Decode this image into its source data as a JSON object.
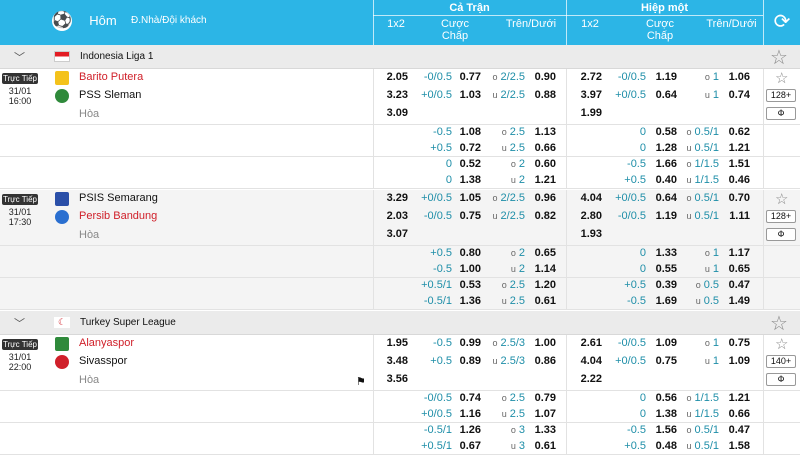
{
  "header": {
    "tab_today": "Hôm Nay",
    "hint": "Đ.Nhà/Đội khách",
    "full_time": "Cả Trận",
    "half_time": "Hiệp một",
    "col_1x2": "1x2",
    "col_handicap_1": "Cược",
    "col_handicap_2": "Chấp",
    "col_ou": "Trên/Dưới"
  },
  "leagues": [
    {
      "name": "Indonesia Liga 1"
    },
    {
      "name": "Turkey Super League"
    }
  ],
  "live_label": "Trực Tiếp",
  "matches": [
    {
      "date": "31/01",
      "time": "16:00",
      "home": "Barito Putera",
      "away": "PSS Sleman",
      "draw": "Hòa",
      "more": "128+",
      "mid_sym": "Ф",
      "main": [
        [
          "2.05",
          "-0/0.5",
          "0.77",
          "o",
          "2/2.5",
          "0.90",
          "2.72",
          "-0/0.5",
          "1.19",
          "o",
          "1",
          "1.06"
        ],
        [
          "3.23",
          "+0/0.5",
          "1.03",
          "u",
          "2/2.5",
          "0.88",
          "3.97",
          "+0/0.5",
          "0.64",
          "u",
          "1",
          "0.74"
        ],
        [
          "3.09",
          "",
          "",
          "",
          "",
          "",
          "1.99",
          "",
          "",
          "",
          "",
          ""
        ]
      ],
      "extra": [
        [
          "-0.5",
          "1.08",
          "o",
          "2.5",
          "1.13",
          "0",
          "0.58",
          "o",
          "0.5/1",
          "0.62"
        ],
        [
          "+0.5",
          "0.72",
          "u",
          "2.5",
          "0.66",
          "0",
          "1.28",
          "u",
          "0.5/1",
          "1.21"
        ],
        [
          "0",
          "0.52",
          "o",
          "2",
          "0.60",
          "-0.5",
          "1.66",
          "o",
          "1/1.5",
          "1.51"
        ],
        [
          "0",
          "1.38",
          "u",
          "2",
          "1.21",
          "+0.5",
          "0.40",
          "u",
          "1/1.5",
          "0.46"
        ]
      ]
    },
    {
      "date": "31/01",
      "time": "17:30",
      "home": "PSIS Semarang",
      "away": "Persib Bandung",
      "draw": "Hòa",
      "more": "128+",
      "mid_sym": "Ф",
      "main": [
        [
          "3.29",
          "+0/0.5",
          "1.05",
          "o",
          "2/2.5",
          "0.96",
          "4.04",
          "+0/0.5",
          "0.64",
          "o",
          "0.5/1",
          "0.70"
        ],
        [
          "2.03",
          "-0/0.5",
          "0.75",
          "u",
          "2/2.5",
          "0.82",
          "2.80",
          "-0/0.5",
          "1.19",
          "u",
          "0.5/1",
          "1.11"
        ],
        [
          "3.07",
          "",
          "",
          "",
          "",
          "",
          "1.93",
          "",
          "",
          "",
          "",
          ""
        ]
      ],
      "extra": [
        [
          "+0.5",
          "0.80",
          "o",
          "2",
          "0.65",
          "0",
          "1.33",
          "o",
          "1",
          "1.17"
        ],
        [
          "-0.5",
          "1.00",
          "u",
          "2",
          "1.14",
          "0",
          "0.55",
          "u",
          "1",
          "0.65"
        ],
        [
          "+0.5/1",
          "0.53",
          "o",
          "2.5",
          "1.20",
          "+0.5",
          "0.39",
          "o",
          "0.5",
          "0.47"
        ],
        [
          "-0.5/1",
          "1.36",
          "u",
          "2.5",
          "0.61",
          "-0.5",
          "1.69",
          "u",
          "0.5",
          "1.49"
        ]
      ]
    },
    {
      "date": "31/01",
      "time": "22:00",
      "home": "Alanyaspor",
      "away": "Sivasspor",
      "draw": "Hòa",
      "more": "140+",
      "mid_sym": "Ф",
      "main": [
        [
          "1.95",
          "-0.5",
          "0.99",
          "o",
          "2.5/3",
          "1.00",
          "2.61",
          "-0/0.5",
          "1.09",
          "o",
          "1",
          "0.75"
        ],
        [
          "3.48",
          "+0.5",
          "0.89",
          "u",
          "2.5/3",
          "0.86",
          "4.04",
          "+0/0.5",
          "0.75",
          "u",
          "1",
          "1.09"
        ],
        [
          "3.56",
          "",
          "",
          "",
          "",
          "",
          "2.22",
          "",
          "",
          "",
          "",
          ""
        ]
      ],
      "extra": [
        [
          "-0/0.5",
          "0.74",
          "o",
          "2.5",
          "0.79",
          "0",
          "0.56",
          "o",
          "1/1.5",
          "1.21"
        ],
        [
          "+0/0.5",
          "1.16",
          "u",
          "2.5",
          "1.07",
          "0",
          "1.38",
          "u",
          "1/1.5",
          "0.66"
        ],
        [
          "-0.5/1",
          "1.26",
          "o",
          "3",
          "1.33",
          "-0.5",
          "1.56",
          "o",
          "0.5/1",
          "0.47"
        ],
        [
          "+0.5/1",
          "0.67",
          "u",
          "3",
          "0.61",
          "+0.5",
          "0.48",
          "u",
          "0.5/1",
          "1.58"
        ]
      ]
    }
  ],
  "colors": {
    "header": "#2cb5e6",
    "handicap": "#1e8ea8",
    "red_team": "#d0202a"
  }
}
